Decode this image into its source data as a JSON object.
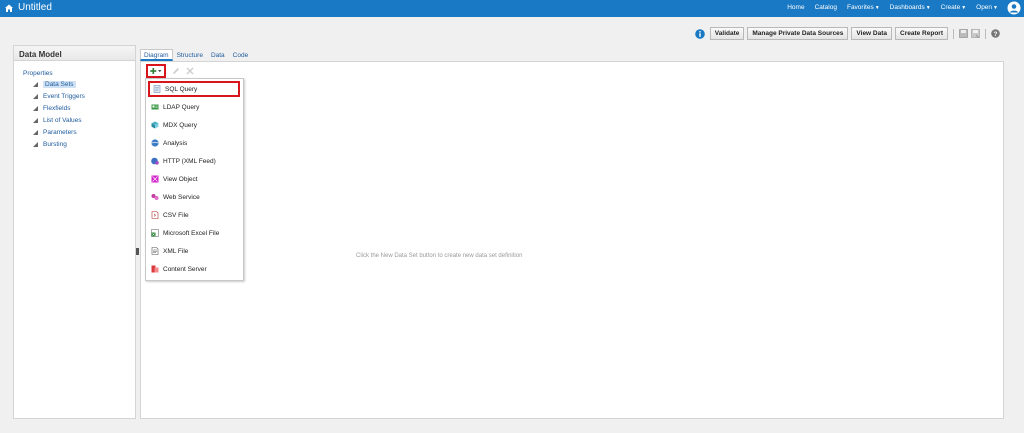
{
  "app": {
    "title": "Untitled"
  },
  "topnav": [
    {
      "label": "Home",
      "dropdown": false
    },
    {
      "label": "Catalog",
      "dropdown": false
    },
    {
      "label": "Favorites",
      "dropdown": true
    },
    {
      "label": "Dashboards",
      "dropdown": true
    },
    {
      "label": "Create",
      "dropdown": true
    },
    {
      "label": "Open",
      "dropdown": true
    }
  ],
  "toolbar": {
    "validate": "Validate",
    "manage_sources": "Manage Private Data Sources",
    "view_data": "View Data",
    "create_report": "Create Report"
  },
  "left_panel": {
    "title": "Data Model",
    "root": "Properties",
    "items": [
      {
        "label": "Data Sets"
      },
      {
        "label": "Event Triggers"
      },
      {
        "label": "Flexfields"
      },
      {
        "label": "List of Values"
      },
      {
        "label": "Parameters"
      },
      {
        "label": "Bursting"
      }
    ]
  },
  "tabs": [
    {
      "label": "Diagram"
    },
    {
      "label": "Structure"
    },
    {
      "label": "Data"
    },
    {
      "label": "Code"
    }
  ],
  "canvas": {
    "hint": "Click the New Data Set button to create new data set definition"
  },
  "menu": [
    {
      "label": "SQL Query",
      "icon": "sql-query-icon"
    },
    {
      "label": "LDAP Query",
      "icon": "ldap-query-icon"
    },
    {
      "label": "MDX Query",
      "icon": "mdx-query-icon"
    },
    {
      "label": "Analysis",
      "icon": "analysis-icon"
    },
    {
      "label": "HTTP (XML Feed)",
      "icon": "http-feed-icon"
    },
    {
      "label": "View Object",
      "icon": "view-object-icon"
    },
    {
      "label": "Web Service",
      "icon": "web-service-icon"
    },
    {
      "label": "CSV File",
      "icon": "csv-file-icon"
    },
    {
      "label": "Microsoft Excel File",
      "icon": "excel-file-icon"
    },
    {
      "label": "XML File",
      "icon": "xml-file-icon"
    },
    {
      "label": "Content Server",
      "icon": "content-server-icon"
    }
  ],
  "colors": {
    "topbar": "#1979c4",
    "link": "#1e5b9c",
    "highlight": "#d9151c"
  }
}
